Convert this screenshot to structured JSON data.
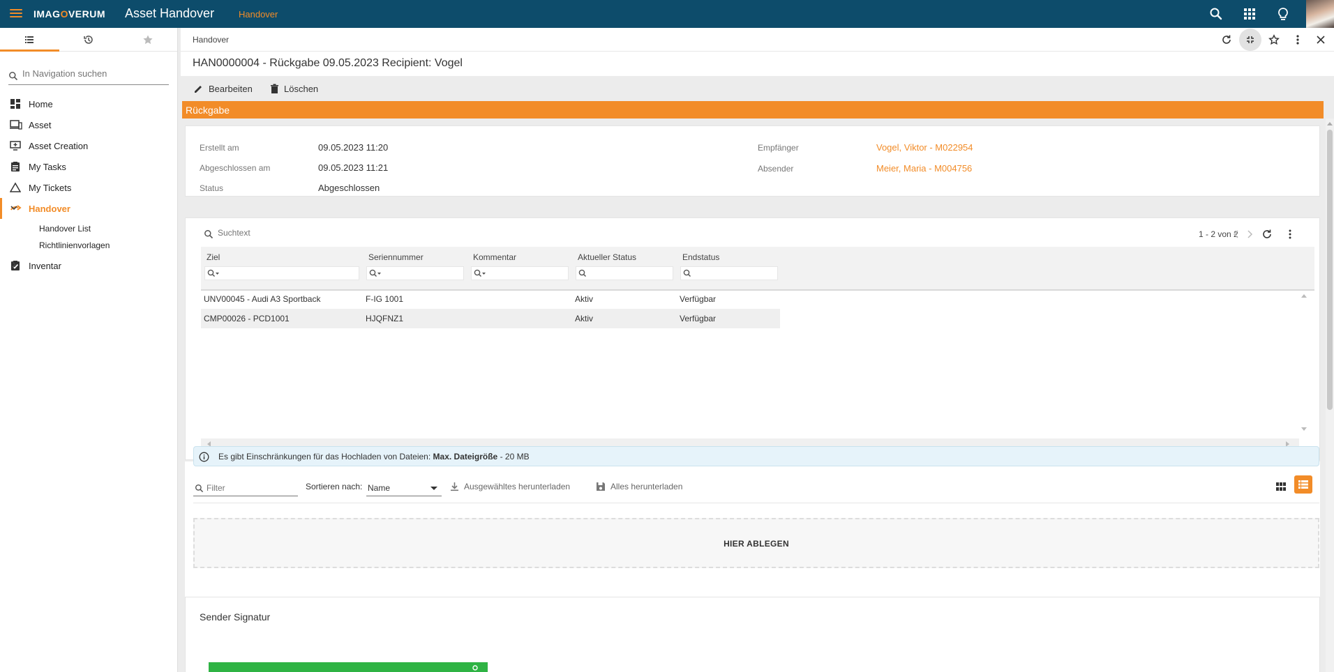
{
  "topbar": {
    "logo_prefix": "IMAG",
    "logo_o": "O",
    "logo_suffix": "VERUM",
    "app_title": "Asset Handover",
    "module": "Handover"
  },
  "sidebar": {
    "search_placeholder": "In Navigation suchen",
    "items": [
      {
        "label": "Home",
        "icon": "dashboard-icon"
      },
      {
        "label": "Asset",
        "icon": "devices-icon"
      },
      {
        "label": "Asset Creation",
        "icon": "asset-creation-icon"
      },
      {
        "label": "My Tasks",
        "icon": "clipboard-icon"
      },
      {
        "label": "My Tickets",
        "icon": "warning-triangle-icon"
      },
      {
        "label": "Handover",
        "icon": "handover-icon"
      },
      {
        "label": "Inventar",
        "icon": "checklist-icon"
      }
    ],
    "sub_items": [
      "Handover List",
      "Richtlinienvorlagen"
    ]
  },
  "header": {
    "breadcrumb": "Handover",
    "title": "HAN0000004 - Rückgabe 09.05.2023 Recipient: Vogel"
  },
  "toolbar": {
    "edit_label": "Bearbeiten",
    "delete_label": "Löschen"
  },
  "section": {
    "title": "Rückgabe"
  },
  "details": {
    "created_label": "Erstellt am",
    "created_value": "09.05.2023 11:20",
    "closed_label": "Abgeschlossen am",
    "closed_value": "09.05.2023 11:21",
    "status_label": "Status",
    "status_value": "Abgeschlossen",
    "recipient_label": "Empfänger",
    "recipient_value": "Vogel, Viktor - M022954",
    "sender_label": "Absender",
    "sender_value": "Meier, Maria - M004756"
  },
  "grid": {
    "search_placeholder": "Suchtext",
    "pagination": "1 - 2 von 2",
    "columns": [
      "Ziel",
      "Seriennummer",
      "Kommentar",
      "Aktueller Status",
      "Endstatus"
    ],
    "rows": [
      [
        "UNV00045 - Audi A3 Sportback",
        "F-IG 1001",
        "",
        "Aktiv",
        "Verfügbar"
      ],
      [
        "CMP00026 - PCD1001",
        "HJQFNZ1",
        "",
        "Aktiv",
        "Verfügbar"
      ]
    ]
  },
  "upload": {
    "info_prefix": "Es gibt Einschränkungen für das Hochladen von Dateien: ",
    "info_bold": "Max. Dateigröße",
    "info_suffix": " - 20 MB",
    "filter_placeholder": "Filter",
    "sort_label": "Sortieren nach:",
    "sort_value": "Name",
    "download_selected": "Ausgewähltes herunterladen",
    "download_all": "Alles herunterladen",
    "dropzone": "HIER ABLEGEN"
  },
  "signature": {
    "title": "Sender Signatur"
  },
  "colors": {
    "topbar": "#0d4c6b",
    "accent": "#f28c28",
    "signature_pad": "#2fb344"
  }
}
